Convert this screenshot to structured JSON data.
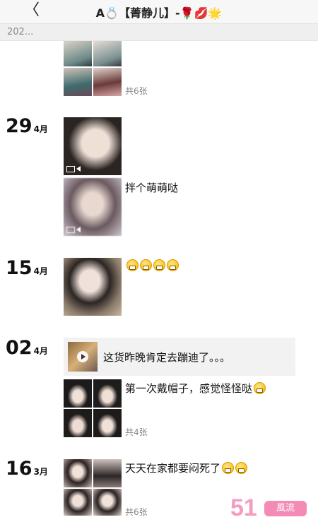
{
  "header": {
    "back_label": "〈",
    "title": "A💍【菁静儿】-🌹💋🌟"
  },
  "year_label": "202...",
  "entries": [
    {
      "count_label": "共6张"
    },
    {
      "day": "29",
      "month": "4月",
      "caption": "拌个萌萌哒"
    },
    {
      "day": "15",
      "month": "4月"
    },
    {
      "day": "02",
      "month": "4月",
      "share_text": "这货昨晚肯定去蹦迪了。。。",
      "caption": "第一次戴帽子，感觉怪怪哒",
      "count_label": "共4张"
    },
    {
      "day": "16",
      "month": "3月",
      "caption": "天天在家都要闷死了",
      "count_label": "共6张"
    }
  ],
  "watermark": {
    "number": "51",
    "badge": "風流"
  }
}
